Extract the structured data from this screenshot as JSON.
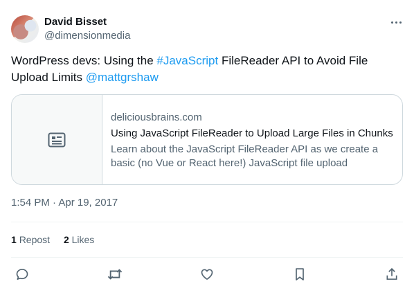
{
  "author": {
    "name": "David Bisset",
    "handle": "@dimensionmedia"
  },
  "tweet": {
    "text_before": "WordPress devs: Using the ",
    "hashtag": "#JavaScript",
    "text_middle": " FileReader API to Avoid File Upload Limits ",
    "mention": "@mattgrshaw"
  },
  "card": {
    "domain": "deliciousbrains.com",
    "title": "Using JavaScript FileReader to Upload Large Files in Chunks",
    "description": "Learn about the JavaScript FileReader API as we create a basic (no Vue or React here!) JavaScript file upload exampl…",
    "thumbnail_icon": "article-icon"
  },
  "timestamp": "1:54 PM · Apr 19, 2017",
  "stats": {
    "reposts_count": "1",
    "reposts_label": "Repost",
    "likes_count": "2",
    "likes_label": "Likes"
  },
  "actions": [
    "reply-icon",
    "repost-icon",
    "like-icon",
    "bookmark-icon",
    "share-icon"
  ],
  "colors": {
    "link": "#1d9bf0",
    "text": "#0f1419",
    "secondary": "#536471",
    "border": "#cfd9de"
  }
}
